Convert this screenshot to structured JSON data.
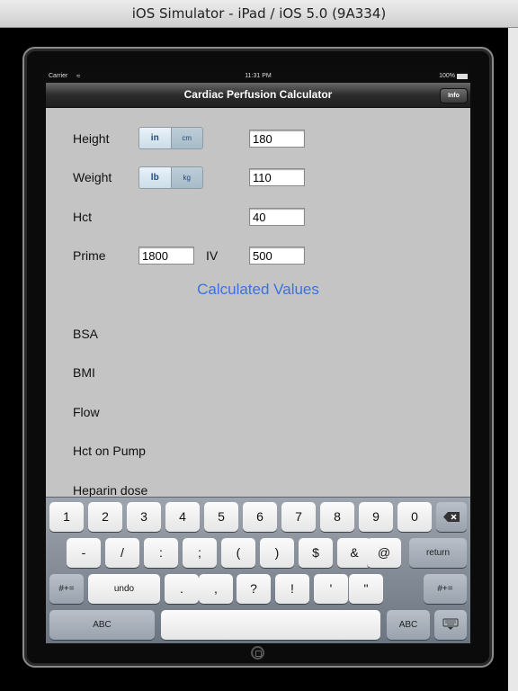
{
  "window": {
    "title": "iOS Simulator - iPad / iOS 5.0 (9A334)"
  },
  "status_bar": {
    "carrier": "Carrier",
    "time": "11:31 PM",
    "battery": "100%"
  },
  "nav": {
    "title": "Cardiac Perfusion Calculator",
    "info_label": "Info"
  },
  "form": {
    "height": {
      "label": "Height",
      "value": "180",
      "units": [
        "in",
        "cm"
      ],
      "selected_unit": "in"
    },
    "weight": {
      "label": "Weight",
      "value": "110",
      "units": [
        "lb",
        "kg"
      ],
      "selected_unit": "lb"
    },
    "hct": {
      "label": "Hct",
      "value": "40"
    },
    "prime": {
      "label": "Prime",
      "value": "1800"
    },
    "iv": {
      "label": "IV",
      "value": "500"
    }
  },
  "calculated": {
    "header": "Calculated Values",
    "labels": [
      "BSA",
      "BMI",
      "Flow",
      "Hct on Pump",
      "Heparin dose"
    ]
  },
  "keyboard": {
    "row1": [
      "1",
      "2",
      "3",
      "4",
      "5",
      "6",
      "7",
      "8",
      "9",
      "0"
    ],
    "row2": [
      "-",
      "/",
      ":",
      ";",
      "(",
      ")",
      "$",
      "&",
      "@"
    ],
    "return_label": "return",
    "row3_symbols_left": "#+=",
    "undo_label": "undo",
    "row3": [
      ".",
      ",",
      "?",
      "!",
      "'",
      "\""
    ],
    "row3_symbols_right": "#+=",
    "abc_left": "ABC",
    "abc_right": "ABC"
  },
  "icons": {
    "wifi": "wifi-icon",
    "battery": "battery-icon",
    "backspace": "backspace-icon",
    "dismiss_keyboard": "keyboard-dismiss-icon"
  },
  "colors": {
    "accent_blue": "#3a72e0",
    "screen_bg": "#c4c4c4"
  }
}
